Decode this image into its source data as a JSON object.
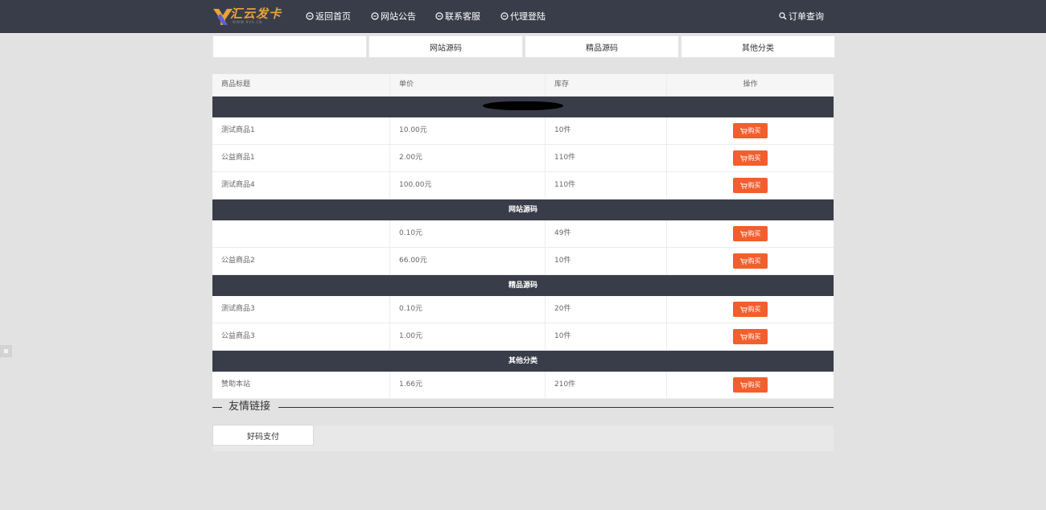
{
  "header": {
    "logo_text": "汇云发卡",
    "logo_sub": "WWW.9VA.CN",
    "nav": [
      {
        "label": "返回首页",
        "icon": "home-icon"
      },
      {
        "label": "网站公告",
        "icon": "notice-icon"
      },
      {
        "label": "联系客服",
        "icon": "service-icon"
      },
      {
        "label": "代理登陆",
        "icon": "agent-icon"
      }
    ],
    "order_query": "订单查询"
  },
  "tabs": [
    "",
    "网站源码",
    "精品源码",
    "其他分类"
  ],
  "table": {
    "headers": [
      "商品标题",
      "单价",
      "库存",
      "操作"
    ],
    "buy_label": "购买",
    "groups": [
      {
        "category": "",
        "items": [
          {
            "title": "测试商品1",
            "price": "10.00元",
            "stock": "10件"
          },
          {
            "title": "公益商品1",
            "price": "2.00元",
            "stock": "110件"
          },
          {
            "title": "测试商品4",
            "price": "100.00元",
            "stock": "110件"
          }
        ]
      },
      {
        "category": "网站源码",
        "items": [
          {
            "title": "",
            "price": "0.10元",
            "stock": "49件"
          },
          {
            "title": "公益商品2",
            "price": "66.00元",
            "stock": "10件"
          }
        ]
      },
      {
        "category": "精品源码",
        "items": [
          {
            "title": "测试商品3",
            "price": "0.10元",
            "stock": "20件"
          },
          {
            "title": "公益商品3",
            "price": "1.00元",
            "stock": "10件"
          }
        ]
      },
      {
        "category": "其他分类",
        "items": [
          {
            "title": "赞助本站",
            "price": "1.66元",
            "stock": "210件"
          }
        ]
      }
    ]
  },
  "friends": {
    "title": "友情链接",
    "links": [
      "好码支付"
    ]
  },
  "colors": {
    "header_bg": "#393d49",
    "buy_button": "#f25f2c",
    "logo_accent": "#e8a33c"
  }
}
